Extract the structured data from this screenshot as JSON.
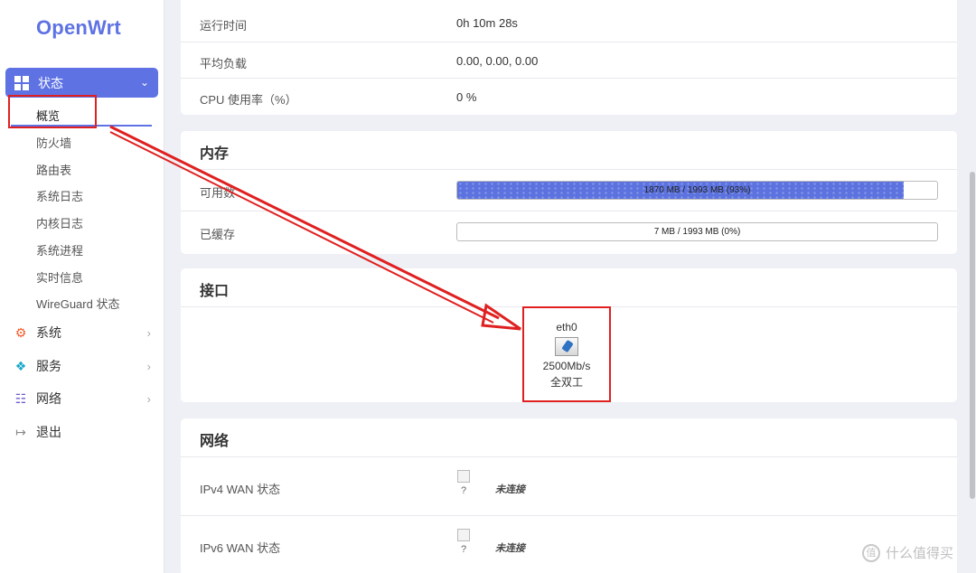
{
  "sidebar": {
    "logo": "OpenWrt",
    "active_menu": "状态",
    "submenu": [
      "概览",
      "防火墙",
      "路由表",
      "系统日志",
      "内核日志",
      "系统进程",
      "实时信息",
      "WireGuard 状态"
    ],
    "menu": [
      {
        "label": "系统",
        "icon": "gear-icon"
      },
      {
        "label": "服务",
        "icon": "services-icon"
      },
      {
        "label": "网络",
        "icon": "network-icon"
      },
      {
        "label": "退出",
        "icon": "logout-icon"
      }
    ]
  },
  "system": {
    "rows": [
      {
        "label": "运行时间",
        "value": "0h 10m 28s"
      },
      {
        "label": "平均负载",
        "value": "0.00, 0.00, 0.00"
      },
      {
        "label": "CPU 使用率（%）",
        "value": "0 %"
      }
    ]
  },
  "memory": {
    "title": "内存",
    "available_label": "可用数",
    "available_text": "1870 MB / 1993 MB (93%)",
    "available_fraction": 0.93,
    "cached_label": "已缓存",
    "cached_text": "7 MB / 1993 MB (0%)",
    "cached_fraction": 0.0
  },
  "interfaces": {
    "title": "接口",
    "name": "eth0",
    "speed": "2500Mb/s",
    "duplex": "全双工"
  },
  "network": {
    "title": "网络",
    "rows": [
      {
        "label": "IPv4 WAN 状态",
        "icon_text": "?",
        "status": "未连接"
      },
      {
        "label": "IPv6 WAN 状态",
        "icon_text": "?",
        "status": "未连接"
      }
    ]
  },
  "watermark": "什么值得买",
  "colors": {
    "accent": "#5e72e4",
    "highlight": "#e02020"
  }
}
